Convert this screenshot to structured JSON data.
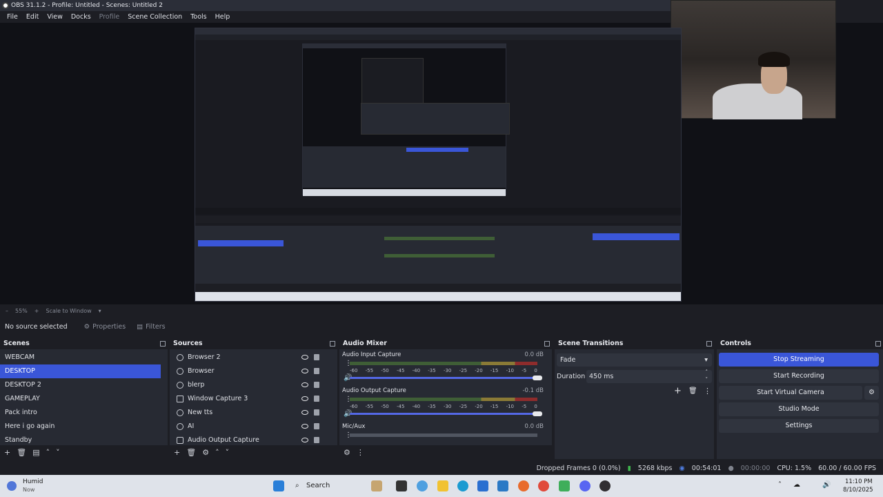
{
  "window": {
    "title": "OBS 31.1.2 - Profile: Untitled - Scenes: Untitled 2"
  },
  "menu": [
    "File",
    "Edit",
    "View",
    "Docks",
    "Profile",
    "Scene Collection",
    "Tools",
    "Help"
  ],
  "preview": {
    "zoom": "55%",
    "scale_mode": "Scale to Window"
  },
  "source_bar": {
    "no_source": "No source selected",
    "properties": "Properties",
    "filters": "Filters"
  },
  "scenes": {
    "title": "Scenes",
    "items": [
      "WEBCAM",
      "DESKTOP",
      "DESKTOP 2",
      "GAMEPLAY",
      "Pack intro",
      "Here i go again",
      "Standby"
    ],
    "selected": "DESKTOP"
  },
  "sources": {
    "title": "Sources",
    "items": [
      "Browser 2",
      "Browser",
      "blerp",
      "Window Capture 3",
      "New tts",
      "AI",
      "Audio Output Capture"
    ]
  },
  "audio_mixer": {
    "title": "Audio Mixer",
    "ticks": [
      "-60",
      "-55",
      "-50",
      "-45",
      "-40",
      "-35",
      "-30",
      "-25",
      "-20",
      "-15",
      "-10",
      "-5",
      "0"
    ],
    "channels": [
      {
        "name": "Audio Input Capture",
        "db": "0.0 dB"
      },
      {
        "name": "Audio Output Capture",
        "db": "-0.1 dB"
      },
      {
        "name": "Mic/Aux",
        "db": "0.0 dB"
      }
    ]
  },
  "transitions": {
    "title": "Scene Transitions",
    "selected": "Fade",
    "duration_label": "Duration",
    "duration": "450 ms"
  },
  "controls": {
    "title": "Controls",
    "stop_streaming": "Stop Streaming",
    "start_recording": "Start Recording",
    "start_virtual_camera": "Start Virtual Camera",
    "studio_mode": "Studio Mode",
    "settings": "Settings"
  },
  "status": {
    "dropped_frames": "Dropped Frames 0 (0.0%)",
    "bitrate": "5268 kbps",
    "stream_time": "00:54:01",
    "record_time": "00:00:00",
    "cpu": "CPU: 1.5%",
    "fps": "60.00 / 60.00 FPS"
  },
  "taskbar": {
    "weather_title": "Humid",
    "weather_sub": "Now",
    "search": "Search",
    "time": "11:10 PM",
    "date": "8/10/2025"
  },
  "colors": {
    "accent": "#3a56d8",
    "panel": "#272a33",
    "background": "#1d1e24"
  }
}
